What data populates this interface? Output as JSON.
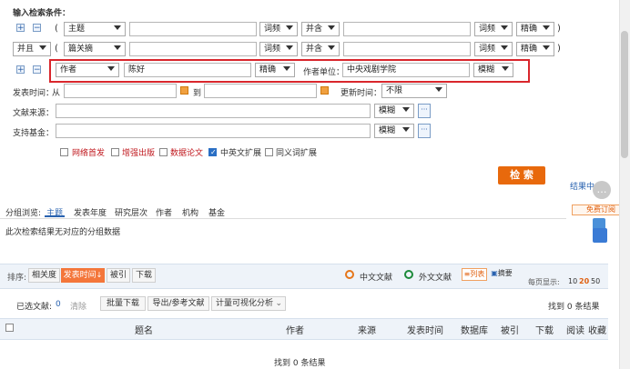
{
  "search": {
    "title": "输入检索条件：",
    "rows": [
      {
        "field": "主题",
        "match_type": "词频",
        "operator": "并含",
        "match_type2": "词频",
        "precision": "精确"
      },
      {
        "logic": "并且",
        "field": "篇关摘",
        "match_type": "词频",
        "operator": "并含",
        "match_type2": "词频",
        "precision": "精确"
      }
    ],
    "author_row": {
      "field": "作者",
      "value": "陈好",
      "precision": "精确",
      "unit_label": "作者单位：",
      "unit_value": "中央戏剧学院",
      "unit_precision": "模糊"
    },
    "publish_time_label": "发表时间：",
    "from_label": "从",
    "to_label": "到",
    "update_time_label": "更新时间：",
    "update_time_value": "不限",
    "source_label": "文献来源：",
    "source_precision": "模糊",
    "fund_label": "支持基金：",
    "fund_precision": "模糊",
    "checkboxes": [
      {
        "label": "网络首发",
        "checked": false,
        "red": true
      },
      {
        "label": "增强出版",
        "checked": false,
        "red": true
      },
      {
        "label": "数据论文",
        "checked": false,
        "red": true
      },
      {
        "label": "中英文扩展",
        "checked": true,
        "red": false
      },
      {
        "label": "同义词扩展",
        "checked": false,
        "red": false
      }
    ],
    "search_button": "检 索",
    "result_link": "结果中",
    "free_subscribe": "免费订阅"
  },
  "group": {
    "label": "分组浏览:",
    "tabs": [
      "主题",
      "发表年度",
      "研究层次",
      "作者",
      "机构",
      "基金"
    ],
    "empty_message": "此次检索结果无对应的分组数据"
  },
  "sort": {
    "label": "排序:",
    "options": [
      "相关度",
      "发表时间",
      "被引",
      "下载"
    ],
    "lang_cn": "中文文献",
    "lang_en": "外文文献",
    "view_list": "列表",
    "view_abstract": "摘要",
    "per_page_label": "每页显示:",
    "per_page": [
      "10",
      "20",
      "50"
    ]
  },
  "toolbar": {
    "selected_label": "已选文献:",
    "selected_count": "0",
    "clear": "清除",
    "batch_download": "批量下载",
    "export": "导出/参考文献",
    "visual": "计量可视化分析",
    "found": "找到 0 条结果"
  },
  "table": {
    "headers": [
      "题名",
      "作者",
      "来源",
      "发表时间",
      "数据库",
      "被引",
      "下载",
      "阅读",
      "收藏"
    ]
  },
  "footer_found": "找到 0 条结果"
}
